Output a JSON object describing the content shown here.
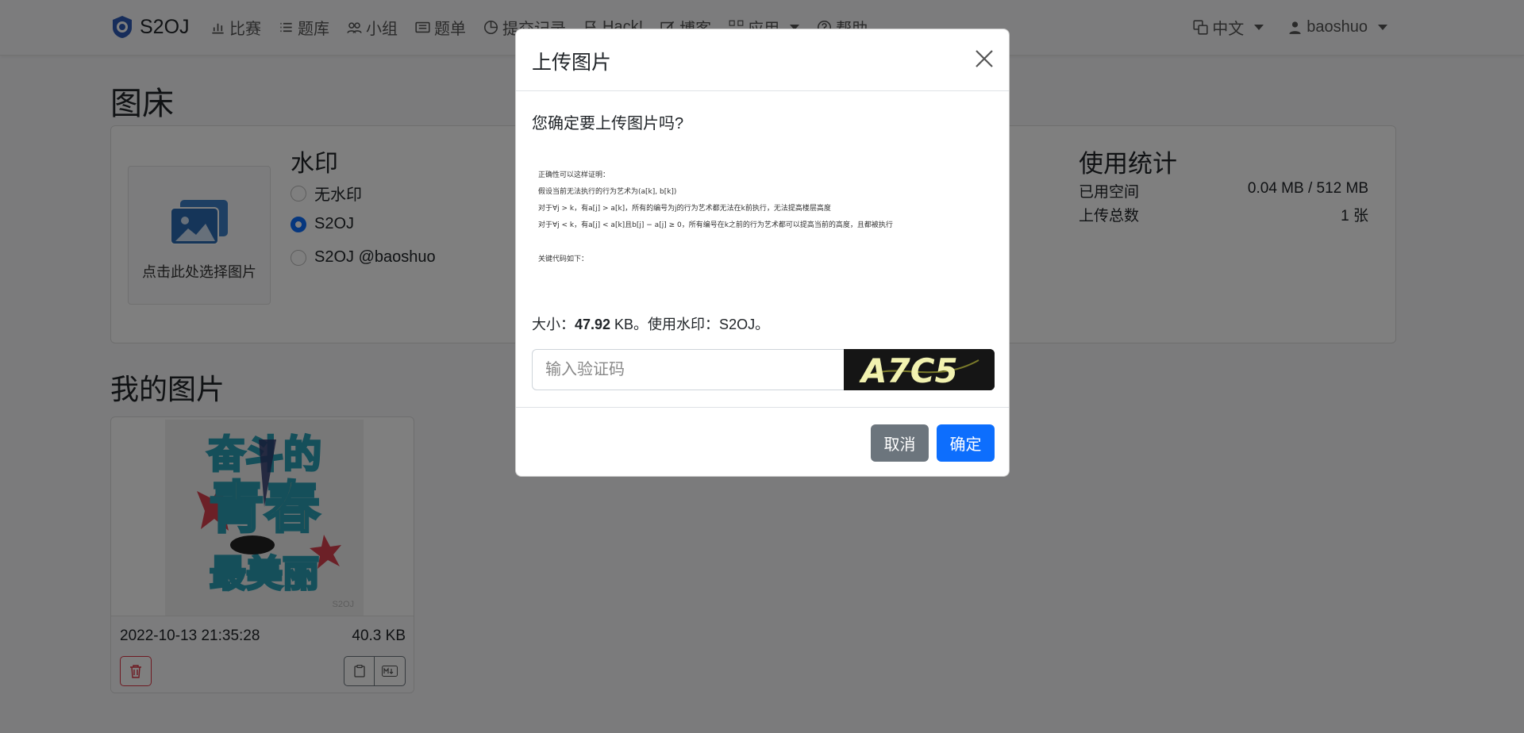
{
  "navbar": {
    "brand": "S2OJ",
    "items": [
      {
        "label": "比赛",
        "icon": "bar-chart-icon"
      },
      {
        "label": "题库",
        "icon": "list-icon"
      },
      {
        "label": "小组",
        "icon": "people-icon"
      },
      {
        "label": "题单",
        "icon": "card-list-icon"
      },
      {
        "label": "提交记录",
        "icon": "pie-chart-icon"
      },
      {
        "label": "Hack!",
        "icon": "flag-icon"
      },
      {
        "label": "博客",
        "icon": "pencil-square-icon"
      },
      {
        "label": "应用",
        "icon": "grid-icon"
      },
      {
        "label": "帮助",
        "icon": "question-circle-icon"
      }
    ],
    "language": "中文",
    "username": "baoshuo"
  },
  "page": {
    "title": "图床",
    "upload_box_label": "点击此处选择图片",
    "watermark": {
      "title": "水印",
      "options": [
        "无水印",
        "S2OJ",
        "S2OJ @baoshuo"
      ],
      "selected": "S2OJ"
    },
    "stats": {
      "title": "使用统计",
      "used_label": "已用空间",
      "used_value": "0.04 MB / 512 MB",
      "count_label": "上传总数",
      "count_value": "1 张"
    },
    "my_images_title": "我的图片",
    "images": [
      {
        "date": "2022-10-13 21:35:28",
        "size": "40.3 KB",
        "watermark": "S2OJ"
      }
    ]
  },
  "modal": {
    "title": "上传图片",
    "question": "您确定要上传图片吗?",
    "preview_lines": [
      "正确性可以这样证明：",
      "假设当前无法执行的行为艺术为(a[k], b[k])",
      "对于∀j > k，有a[j] > a[k]，所有的编号为j的行为艺术都无法在k前执行，无法提高楼层高度",
      "对于∀j < k，有a[j] < a[k]且b[j] − a[j] ≥ 0，所有编号在k之前的行为艺术都可以提高当前的高度，且都被执行",
      "关键代码如下："
    ],
    "size_prefix": "大小：",
    "size_value": "47.92",
    "size_suffix": " KB。使用水印：S2OJ。",
    "captcha_placeholder": "输入验证码",
    "captcha_text": "A7C5",
    "cancel_label": "取消",
    "confirm_label": "确定"
  }
}
